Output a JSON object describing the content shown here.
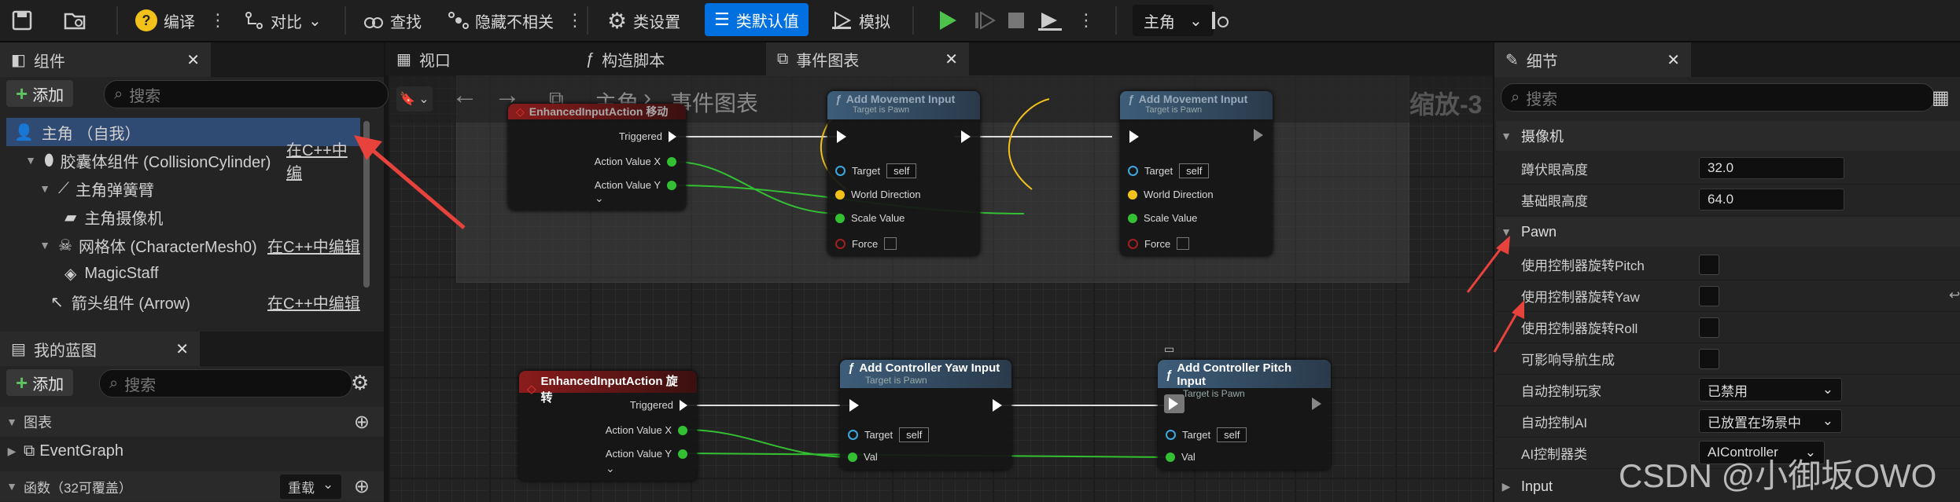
{
  "toolbar": {
    "compile": "编译",
    "diff": "对比",
    "find": "查找",
    "hide_unrelated": "隐藏不相关",
    "class_settings": "类设置",
    "class_defaults": "类默认值",
    "simulate": "模拟",
    "debug_object": "主角"
  },
  "components_panel": {
    "tab": "组件",
    "add": "添加",
    "search_placeholder": "搜索",
    "tree": [
      {
        "label": "主角 （自我）"
      },
      {
        "label": "胶囊体组件 (CollisionCylinder)",
        "link": "在C++中编"
      },
      {
        "label": "主角弹簧臂"
      },
      {
        "label": "主角摄像机"
      },
      {
        "label": "网格体 (CharacterMesh0)",
        "link": "在C++中编辑"
      },
      {
        "label": "MagicStaff"
      },
      {
        "label": "箭头组件 (Arrow)",
        "link": "在C++中编辑"
      }
    ]
  },
  "blueprint_panel": {
    "tab": "我的蓝图",
    "add": "添加",
    "search_placeholder": "搜索",
    "graphs_header": "图表",
    "event_graph": "EventGraph",
    "functions_header": "函数（32可覆盖）",
    "override": "重载"
  },
  "center_tabs": {
    "viewport": "视口",
    "construction": "构造脚本",
    "event_graph": "事件图表"
  },
  "graph": {
    "breadcrumb_root": "主角",
    "breadcrumb_sep": "›",
    "breadcrumb_current": "事件图表",
    "zoom": "缩放-3",
    "nodes": {
      "move_event": {
        "title": "EnhancedInputAction 移动",
        "pins": [
          "Triggered",
          "Action Value X",
          "Action Value Y"
        ]
      },
      "add_move_1": {
        "title": "Add Movement Input",
        "subtitle": "Target is Pawn",
        "pins": [
          "Target",
          "World Direction",
          "Scale Value",
          "Force"
        ],
        "self": "self"
      },
      "add_move_2": {
        "title": "Add Movement Input",
        "subtitle": "Target is Pawn",
        "pins": [
          "Target",
          "World Direction",
          "Scale Value",
          "Force"
        ],
        "self": "self"
      },
      "rotate_event": {
        "title": "EnhancedInputAction 旋转",
        "pins": [
          "Triggered",
          "Action Value X",
          "Action Value Y"
        ]
      },
      "yaw": {
        "title": "Add Controller Yaw Input",
        "subtitle": "Target is Pawn",
        "pins": [
          "Target",
          "Val"
        ],
        "self": "self"
      },
      "pitch": {
        "title": "Add Controller Pitch Input",
        "subtitle": "Target is Pawn",
        "pins": [
          "Target",
          "Val"
        ],
        "self": "self"
      }
    }
  },
  "details": {
    "tab": "细节",
    "search_placeholder": "搜索",
    "camera_header": "摄像机",
    "crouched_eye_label": "蹲伏眼高度",
    "crouched_eye_value": "32.0",
    "base_eye_label": "基础眼高度",
    "base_eye_value": "64.0",
    "pawn_header": "Pawn",
    "pitch_label": "使用控制器旋转Pitch",
    "yaw_label": "使用控制器旋转Yaw",
    "roll_label": "使用控制器旋转Roll",
    "nav_label": "可影响导航生成",
    "auto_possess_player_label": "自动控制玩家",
    "auto_possess_player_value": "已禁用",
    "auto_possess_ai_label": "自动控制AI",
    "auto_possess_ai_value": "已放置在场景中",
    "ai_class_label": "AI控制器类",
    "ai_class_value": "AIController",
    "input_header": "Input"
  },
  "watermark": "CSDN @小御坂OWO",
  "colors": {
    "accent": "#0070e0",
    "exec_red": "#8a1c1c",
    "func_blue": "#3d5d7a",
    "pin_green": "#33c033",
    "pin_yellow": "#f2c21a",
    "pin_blue": "#3da8e0",
    "annotation": "#e8423c"
  }
}
